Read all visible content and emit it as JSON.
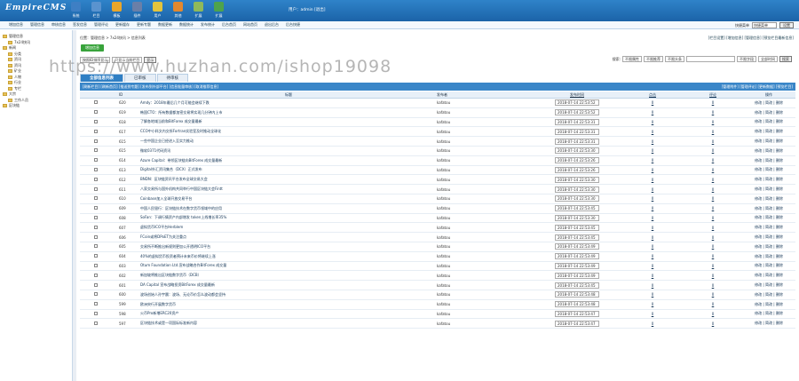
{
  "app": {
    "logo": "EmpireCMS"
  },
  "nav": [
    {
      "label": "系统",
      "color": "#3e7fc4",
      "icon": "system-icon"
    },
    {
      "label": "栏目",
      "color": "#5a93cf",
      "icon": "column-icon"
    },
    {
      "label": "模板",
      "color": "#e9a62a",
      "icon": "template-icon"
    },
    {
      "label": "插件",
      "color": "#6a7fa8",
      "icon": "plugin-icon"
    },
    {
      "label": "用户",
      "color": "#e3c43d",
      "icon": "user-icon"
    },
    {
      "label": "其他",
      "color": "#e2882f",
      "icon": "other-icon"
    },
    {
      "label": "扩展",
      "color": "#8fb95a",
      "icon": "extend-icon"
    },
    {
      "label": "扩展",
      "color": "#4ea34d",
      "icon": "extend2-icon"
    }
  ],
  "user": {
    "text": "用户：admin [退出]"
  },
  "subnav": [
    "增加信息",
    "管理信息",
    "审核信息",
    "签发信息",
    "管理评论",
    "更新缓存",
    "更新专题",
    "数据更新",
    "数据统计",
    "发布统计",
    "后台首页",
    "网站首页",
    "退出后台",
    "后台快捷"
  ],
  "quick": {
    "label": "快捷菜单",
    "select": "快捷菜单",
    "button": "设置"
  },
  "sidebar": {
    "title": "管理信息",
    "items": [
      {
        "label": "7x24快讯",
        "level": 2
      },
      {
        "label": "新闻",
        "level": 1
      },
      {
        "label": "分类",
        "level": 2
      },
      {
        "label": "资讯",
        "level": 2
      },
      {
        "label": "资讯",
        "level": 2
      },
      {
        "label": "矿业",
        "level": 2
      },
      {
        "label": "人物",
        "level": 2
      },
      {
        "label": "行业",
        "level": 2
      },
      {
        "label": "专栏",
        "level": 2
      },
      {
        "label": "大宗",
        "level": 1
      },
      {
        "label": "工作人员",
        "level": 2
      },
      {
        "label": "区块链",
        "level": 1
      }
    ]
  },
  "breadcrumb": "位置：管理信息 > 7x24快讯 > 信息列表",
  "toplinks": "[栏目设置] [增加信息] [管理信息] [预览栏目最新信息]",
  "add_button": "增加信息",
  "filter1": {
    "select1": "按照ID排序显示",
    "select2": "只显示当前栏目",
    "button": "显示"
  },
  "filters_right": {
    "label": "搜索:",
    "s1": "不限属性",
    "s2": "不限推荐",
    "s3": "不限头条",
    "s4": "不限字段",
    "s5": "全部时间",
    "button": "搜索"
  },
  "tabs": [
    "全部信息列表",
    "已审核",
    "待审核"
  ],
  "action_bar": {
    "left": "[刷新栏目] [刷新首页] [推送到专题] [发布到外部平台] [信息批量审核] [取消推荐信息]",
    "right": "[管理附件] [管理评论] [更新数据] [预览栏目]"
  },
  "table": {
    "headers": [
      "",
      "ID",
      "标题",
      "发布者",
      "发布时间",
      "点击",
      "评论",
      "操作"
    ],
    "rows": [
      {
        "id": "620",
        "title": "Amdy：2018年最后几个月可能会继续下跌",
        "author": "kafatou",
        "date": "2018-07-14 22:53:52",
        "clicks": "0",
        "comments": "0",
        "ops": "修改 | 简改 | 删除"
      },
      {
        "id": "619",
        "title": "韩国CTO：所有数据都加密交易将实现几分钟内上市",
        "author": "kafatou",
        "date": "2018-07-14 22:53:52",
        "clicks": "0",
        "comments": "0",
        "ops": "修改 | 简改 | 删除"
      },
      {
        "id": "618",
        "title": "了解各地域当前和BitForex 成交量最新",
        "author": "kafatou",
        "date": "2018-07-14 22:53:31",
        "clicks": "0",
        "comments": "0",
        "ops": "修改 | 简改 | 删除"
      },
      {
        "id": "617",
        "title": "CCO中小科文内交所Fortran实验室及时推动全球化",
        "author": "kafatou",
        "date": "2018-07-14 22:53:31",
        "clicks": "0",
        "comments": "0",
        "ops": "修改 | 简改 | 删除"
      },
      {
        "id": "615",
        "title": "一些中国企业已经进入至实力推动",
        "author": "kafatou",
        "date": "2018-07-14 22:53:31",
        "clicks": "0",
        "comments": "0",
        "ops": "修改 | 简改 | 删除"
      },
      {
        "id": "615",
        "title": "微软0371代码资讯",
        "author": "kafatou",
        "date": "2018-07-14 22:53:30",
        "clicks": "0",
        "comments": "0",
        "ops": "修改 | 简改 | 删除"
      },
      {
        "id": "614",
        "title": "Azure Capital：带领区块链向BitForex 成交量最新",
        "author": "kafatou",
        "date": "2018-07-14 22:53:26",
        "clicks": "0",
        "comments": "0",
        "ops": "修改 | 简改 | 删除"
      },
      {
        "id": "613",
        "title": "Digital外汇资讯集合（DCX）正式发布",
        "author": "kafatou",
        "date": "2018-07-14 22:53:26",
        "clicks": "0",
        "comments": "0",
        "ops": "修改 | 简改 | 删除"
      },
      {
        "id": "612",
        "title": "BNDN：区块链资讯平台发布全球交易大会",
        "author": "kafatou",
        "date": "2018-07-14 22:53:30",
        "clicks": "0",
        "comments": "0",
        "ops": "修改 | 简改 | 删除"
      },
      {
        "id": "611",
        "title": "八家交易所与国外机构共同举行中国区块链大会Fintt",
        "author": "kafatou",
        "date": "2018-07-14 22:53:30",
        "clicks": "0",
        "comments": "0",
        "ops": "修改 | 简改 | 删除"
      },
      {
        "id": "610",
        "title": "Coinbase加入全球开放交易平台",
        "author": "kafatou",
        "date": "2018-07-14 22:53:30",
        "clicks": "0",
        "comments": "0",
        "ops": "修改 | 简改 | 删除"
      },
      {
        "id": "609",
        "title": "中国人民银行：区块链技术在数字货币领域中的应用",
        "author": "kafatou",
        "date": "2018-07-14 22:53:45",
        "clicks": "0",
        "comments": "0",
        "ops": "修改 | 简改 | 删除"
      },
      {
        "id": "608",
        "title": "SoFan：下调行情资产内部增发 token上线增长率35%",
        "author": "kafatou",
        "date": "2018-07-14 22:53:30",
        "clicks": "0",
        "comments": "0",
        "ops": "修改 | 简改 | 删除"
      },
      {
        "id": "607",
        "title": "虚拟货币ICO平台Herblem",
        "author": "kafatou",
        "date": "2018-07-14 22:53:45",
        "clicks": "0",
        "comments": "0",
        "ops": "修改 | 简改 | 删除"
      },
      {
        "id": "606",
        "title": "FCoin或将DPoET为关注重点",
        "author": "kafatou",
        "date": "2018-07-14 22:53:45",
        "clicks": "0",
        "comments": "0",
        "ops": "修改 | 简改 | 删除"
      },
      {
        "id": "605",
        "title": "交易所不断推出新规则更加公开透明ICO平台",
        "author": "kafatou",
        "date": "2018-07-14 22:53:49",
        "clicks": "0",
        "comments": "0",
        "ops": "修改 | 简改 | 删除"
      },
      {
        "id": "604",
        "title": "40%的虚拟货币投资者预计未来币价将继续上涨",
        "author": "kafatou",
        "date": "2018-07-14 22:53:49",
        "clicks": "0",
        "comments": "0",
        "ops": "修改 | 简改 | 删除"
      },
      {
        "id": "603",
        "title": "Otum Foundation Ltd.宣布战略合作BitForex 成交量",
        "author": "kafatou",
        "date": "2018-07-14 22:53:49",
        "clicks": "0",
        "comments": "0",
        "ops": "修改 | 简改 | 删除"
      },
      {
        "id": "602",
        "title": "新加坡将推出区块链数字货币（DCB）",
        "author": "kafatou",
        "date": "2018-07-14 22:53:49",
        "clicks": "0",
        "comments": "0",
        "ops": "修改 | 简改 | 删除"
      },
      {
        "id": "601",
        "title": "DA Capital 宣布战略投资BitForex 成交量最新",
        "author": "kafatou",
        "date": "2018-07-14 22:53:45",
        "clicks": "0",
        "comments": "0",
        "ops": "修改 | 简改 | 删除"
      },
      {
        "id": "600",
        "title": "波场创始人孙宇晨：波场、无论币价怎么波动都会坚持",
        "author": "kafatou",
        "date": "2018-07-14 22:53:48",
        "clicks": "0",
        "comments": "0",
        "ops": "修改 | 简改 | 删除"
      },
      {
        "id": "599",
        "title": "欧洲央行开展数字货币",
        "author": "kafatou",
        "date": "2018-07-14 22:53:48",
        "clicks": "0",
        "comments": "0",
        "ops": "修改 | 简改 | 删除"
      },
      {
        "id": "598",
        "title": "火币Pro新增ERC20资产",
        "author": "kafatou",
        "date": "2018-07-14 22:53:47",
        "clicks": "0",
        "comments": "0",
        "ops": "修改 | 简改 | 删除"
      },
      {
        "id": "597",
        "title": "区块链技术或是一项国际标准新内容",
        "author": "kafatou",
        "date": "2018-07-14 22:53:47",
        "clicks": "0",
        "comments": "0",
        "ops": "修改 | 简改 | 删除"
      }
    ]
  },
  "watermark": "https://www.huzhan.com/ishop19098"
}
